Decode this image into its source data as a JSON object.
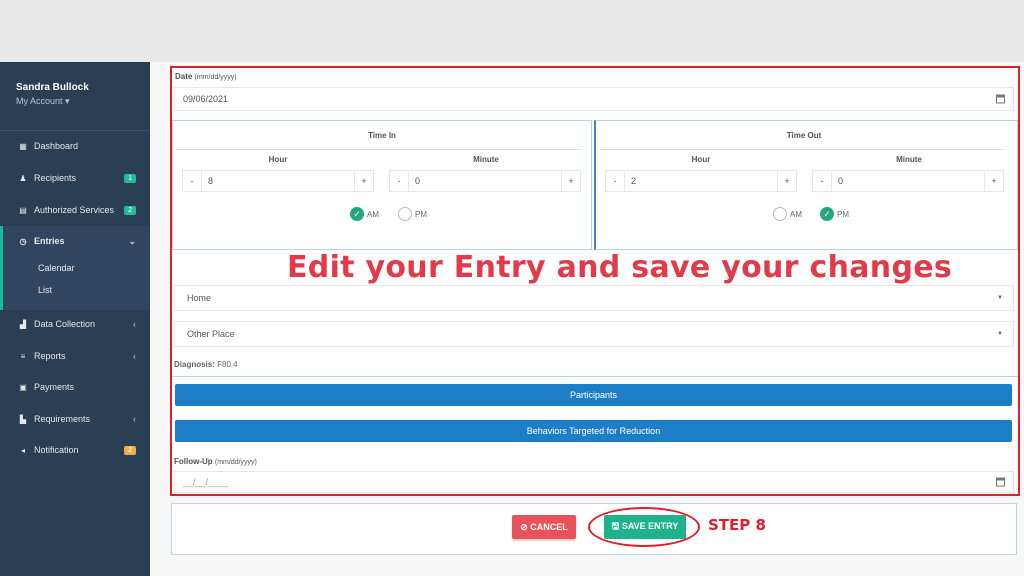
{
  "sidebar": {
    "user_name": "Sandra Bullock",
    "my_account": "My Account ▾",
    "items": [
      {
        "label": "Dashboard",
        "icon": "dashboard-icon"
      },
      {
        "label": "Recipients",
        "icon": "user-icon",
        "badge": "1",
        "badge_color": "#26b99a"
      },
      {
        "label": "Authorized Services",
        "icon": "calculator-icon",
        "badge": "2",
        "badge_color": "#26b99a"
      },
      {
        "label": "Entries",
        "icon": "clock-icon",
        "chevron": "⌄"
      },
      {
        "label": "Data Collection",
        "icon": "chart-icon",
        "chevron": "‹"
      },
      {
        "label": "Reports",
        "icon": "list-icon",
        "chevron": "‹"
      },
      {
        "label": "Payments",
        "icon": "money-icon"
      },
      {
        "label": "Requirements",
        "icon": "file-icon",
        "chevron": "‹"
      },
      {
        "label": "Notification",
        "icon": "bullhorn-icon",
        "badge": "2",
        "badge_color": "#f0ad4e"
      }
    ],
    "sub_items": [
      "Calendar",
      "List"
    ]
  },
  "form": {
    "date_label": "Date",
    "date_format": "(mm/dd/yyyy)",
    "date_value": "09/06/2021",
    "time_in": {
      "title": "Time In",
      "hour_label": "Hour",
      "hour_value": "8",
      "minute_label": "Minute",
      "minute_value": "0",
      "am_label": "AM",
      "pm_label": "PM",
      "selected": "AM"
    },
    "time_out": {
      "title": "Time Out",
      "hour_label": "Hour",
      "hour_value": "2",
      "minute_label": "Minute",
      "minute_value": "0",
      "am_label": "AM",
      "pm_label": "PM",
      "selected": "PM"
    },
    "minus": "-",
    "plus": "+",
    "location_select": "Home",
    "place_select": "Other Place",
    "diagnosis_label": "Diagnosis:",
    "diagnosis_value": "F80.4",
    "participants_button": "Participants",
    "behaviors_button": "Behaviors Targeted for Reduction",
    "followup_label": "Follow-Up",
    "followup_format": "(mm/dd/yyyy)",
    "followup_placeholder": "__/__/____"
  },
  "actions": {
    "cancel_label": "⊘ CANCEL",
    "save_label": "🖫 SAVE ENTRY"
  },
  "annotation": {
    "headline": "Edit your Entry and save your changes",
    "step": "STEP 8",
    "color": "#e01f2b"
  }
}
